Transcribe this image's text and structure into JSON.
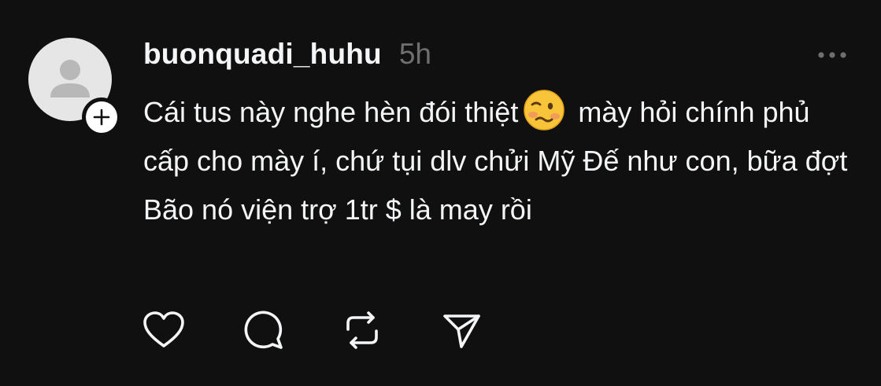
{
  "post": {
    "author": "buonquadi_huhu",
    "timestamp": "5h",
    "body_part1": "Cái tus này nghe hèn đói thiệt",
    "body_emoji": "woozy-face-emoji",
    "body_part2": " mày hỏi chính phủ cấp cho mày í, chứ tụi dlv chửi Mỹ Đế như con, bữa đợt Bão nó viện trợ 1tr $ là may rồi"
  },
  "icons": {
    "avatar": "default-avatar-icon",
    "follow": "plus-icon",
    "more": "more-horizontal-icon",
    "like": "heart-icon",
    "reply": "comment-icon",
    "repost": "repost-icon",
    "share": "send-icon"
  },
  "colors": {
    "background": "#101010",
    "text": "#f3f5f7",
    "muted": "#6f6f6f",
    "avatar_bg": "#e6e6e6",
    "avatar_fg": "#b8b8b8"
  }
}
